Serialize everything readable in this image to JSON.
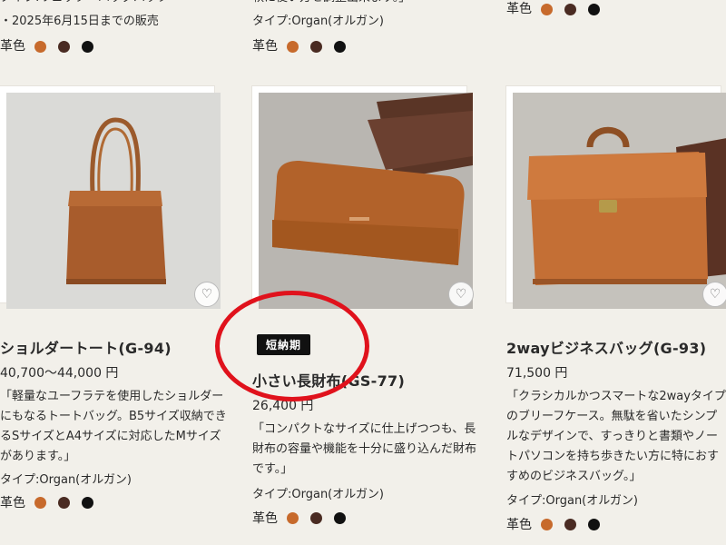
{
  "top": {
    "left_line1": "タイプ:リュック・バッグパック",
    "left_line2": "・2025年6月15日までの販売",
    "middle_line1": "軟に使い方を調整出来ます。」",
    "middle_line2": "タイプ:Organ(オルガン)",
    "color_label": "革色"
  },
  "colors": {
    "tan": "#c76a2c",
    "brown": "#4a2b22",
    "black": "#111111",
    "accent_red": "#e0121c"
  },
  "products": [
    {
      "title": "ショルダートート(G-94)",
      "price": "40,700〜44,000 円",
      "description": "「軽量なユーフラテを使用したショルダーにもなるトートバッグ。B5サイズ収納できるSサイズとA4サイズに対応したMサイズがあります。」",
      "type": "タイプ:Organ(オルガン)",
      "color_label": "革色"
    },
    {
      "badge": "短納期",
      "title": "小さい長財布(GS-77)",
      "price": "26,400 円",
      "description": "「コンパクトなサイズに仕上げつつも、長財布の容量や機能を十分に盛り込んだ財布です。」",
      "type": "タイプ:Organ(オルガン)",
      "color_label": "革色"
    },
    {
      "title": "2wayビジネスバッグ(G-93)",
      "price": "71,500 円",
      "description": "「クラシカルかつスマートな2wayタイプのブリーフケース。無駄を省いたシンプルなデザインで、すっきりと書類やノートパソコンを持ち歩きたい方に特におすすめのビジネスバッグ。」",
      "type": "タイプ:Organ(オルガン)",
      "color_label": "革色"
    }
  ]
}
